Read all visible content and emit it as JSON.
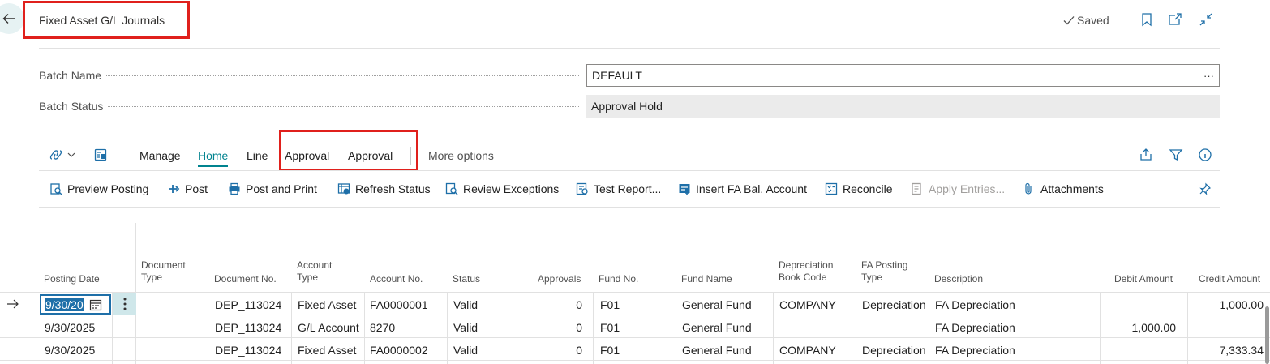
{
  "header": {
    "title": "Fixed Asset G/L Journals",
    "saved_label": "Saved"
  },
  "fields": {
    "batch_name_label": "Batch Name",
    "batch_name_value": "DEFAULT",
    "batch_name_more": "···",
    "batch_status_label": "Batch Status",
    "batch_status_value": "Approval Hold"
  },
  "tabs": [
    {
      "label": "Manage"
    },
    {
      "label": "Home",
      "active": true
    },
    {
      "label": "Line"
    },
    {
      "label": "Approval"
    },
    {
      "label": "Approval"
    },
    {
      "label": "More options"
    }
  ],
  "actions": [
    {
      "label": "Preview Posting",
      "icon": "preview-posting-icon"
    },
    {
      "label": "Post",
      "icon": "post-icon"
    },
    {
      "label": "Post and Print",
      "icon": "print-icon"
    },
    {
      "label": "Refresh Status",
      "icon": "refresh-status-icon"
    },
    {
      "label": "Review Exceptions",
      "icon": "review-exceptions-icon"
    },
    {
      "label": "Test Report...",
      "icon": "test-report-icon"
    },
    {
      "label": "Insert FA Bal. Account",
      "icon": "insert-fa-icon"
    },
    {
      "label": "Reconcile",
      "icon": "reconcile-icon"
    },
    {
      "label": "Apply Entries...",
      "icon": "apply-entries-icon",
      "disabled": true
    },
    {
      "label": "Attachments",
      "icon": "paperclip-icon"
    }
  ],
  "grid": {
    "columns": {
      "posting_date": "Posting Date",
      "document_type_1": "Document",
      "document_type_2": "Type",
      "document_no": "Document No.",
      "account_type_1": "Account",
      "account_type_2": "Type",
      "account_no": "Account No.",
      "status": "Status",
      "approvals": "Approvals",
      "fund_no": "Fund No.",
      "fund_name": "Fund Name",
      "depr_book_1": "Depreciation",
      "depr_book_2": "Book Code",
      "fa_posting_1": "FA Posting",
      "fa_posting_2": "Type",
      "description": "Description",
      "debit": "Debit Amount",
      "credit": "Credit Amount"
    },
    "rows": [
      {
        "posting_date": "9/30/20",
        "document_no": "DEP_113024",
        "account_type": "Fixed Asset",
        "account_no": "FA0000001",
        "status": "Valid",
        "approvals": "0",
        "fund_no": "F01",
        "fund_name": "General Fund",
        "depr_book": "COMPANY",
        "fa_posting": "Depreciation",
        "description": "FA Depreciation",
        "debit": "",
        "credit": "1,000.00"
      },
      {
        "posting_date": "9/30/2025",
        "document_no": "DEP_113024",
        "account_type": "G/L Account",
        "account_no": "8270",
        "status": "Valid",
        "approvals": "0",
        "fund_no": "F01",
        "fund_name": "General Fund",
        "depr_book": "",
        "fa_posting": "",
        "description": "FA Depreciation",
        "debit": "1,000.00",
        "credit": ""
      },
      {
        "posting_date": "9/30/2025",
        "document_no": "DEP_113024",
        "account_type": "Fixed Asset",
        "account_no": "FA0000002",
        "status": "Valid",
        "approvals": "0",
        "fund_no": "F01",
        "fund_name": "General Fund",
        "depr_book": "COMPANY",
        "fa_posting": "Depreciation",
        "description": "FA Depreciation",
        "debit": "",
        "credit": "7,333.34"
      }
    ]
  },
  "colors": {
    "accent": "#00838f",
    "highlight": "#e0201c",
    "selection": "#1e6fa8"
  }
}
